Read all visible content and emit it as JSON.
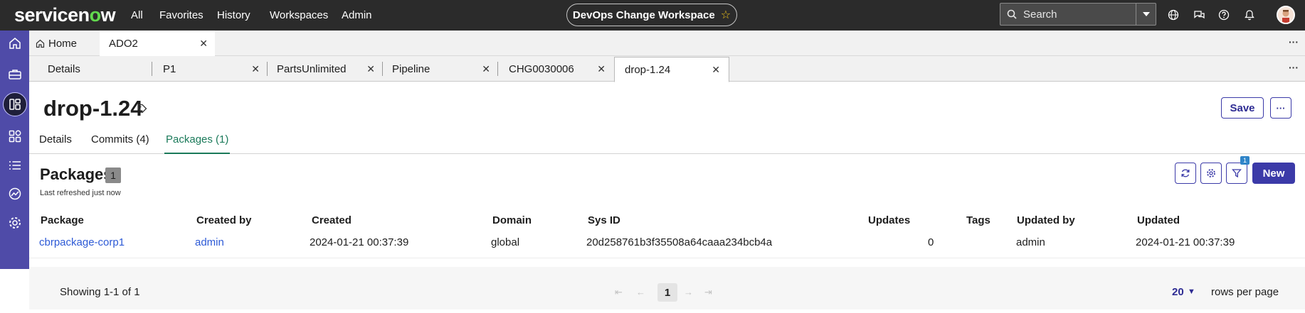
{
  "brand": {
    "logo_prefix": "servicen",
    "logo_o": "o",
    "logo_suffix": "w"
  },
  "topnav": {
    "links": [
      "All",
      "Favorites",
      "History",
      "Workspaces",
      "Admin"
    ],
    "workspace": "DevOps Change Workspace",
    "search_placeholder": "Search"
  },
  "tabs_primary": [
    {
      "label": "Home",
      "icon": "home-icon"
    },
    {
      "label": "ADO2",
      "active": true
    }
  ],
  "tabs_secondary": [
    {
      "label": "Details"
    },
    {
      "label": "P1"
    },
    {
      "label": "PartsUnlimited"
    },
    {
      "label": "Pipeline"
    },
    {
      "label": "CHG0030006"
    },
    {
      "label": "drop-1.24",
      "active": true
    }
  ],
  "record": {
    "title": "drop-1.24",
    "save_label": "Save"
  },
  "subtabs": [
    {
      "label": "Details"
    },
    {
      "label": "Commits (4)"
    },
    {
      "label": "Packages (1)",
      "active": true
    }
  ],
  "list": {
    "title": "Packages",
    "count": "1",
    "refreshed": "Last refreshed just now",
    "filter_count": "1",
    "new_label": "New",
    "columns": [
      "Package",
      "Created by",
      "Created",
      "Domain",
      "Sys ID",
      "Updates",
      "Tags",
      "Updated by",
      "Updated"
    ],
    "rows": [
      {
        "package": "cbrpackage-corp1",
        "created_by": "admin",
        "created": "2024-01-21 00:37:39",
        "domain": "global",
        "sys_id": "20d258761b3f35508a64caaa234bcb4a",
        "updates": "0",
        "tags": "",
        "updated_by": "admin",
        "updated": "2024-01-21 00:37:39"
      }
    ]
  },
  "pagination": {
    "showing": "Showing 1-1 of 1",
    "current_page": "1",
    "rows_per_page_value": "20",
    "rows_per_page_label": "rows per page"
  },
  "colors": {
    "topbar": "#2b2b2b",
    "rail": "#4f4ba8",
    "primary": "#3b3aa8",
    "active_subtab": "#1b7a5a",
    "link": "#2d5ad6"
  }
}
